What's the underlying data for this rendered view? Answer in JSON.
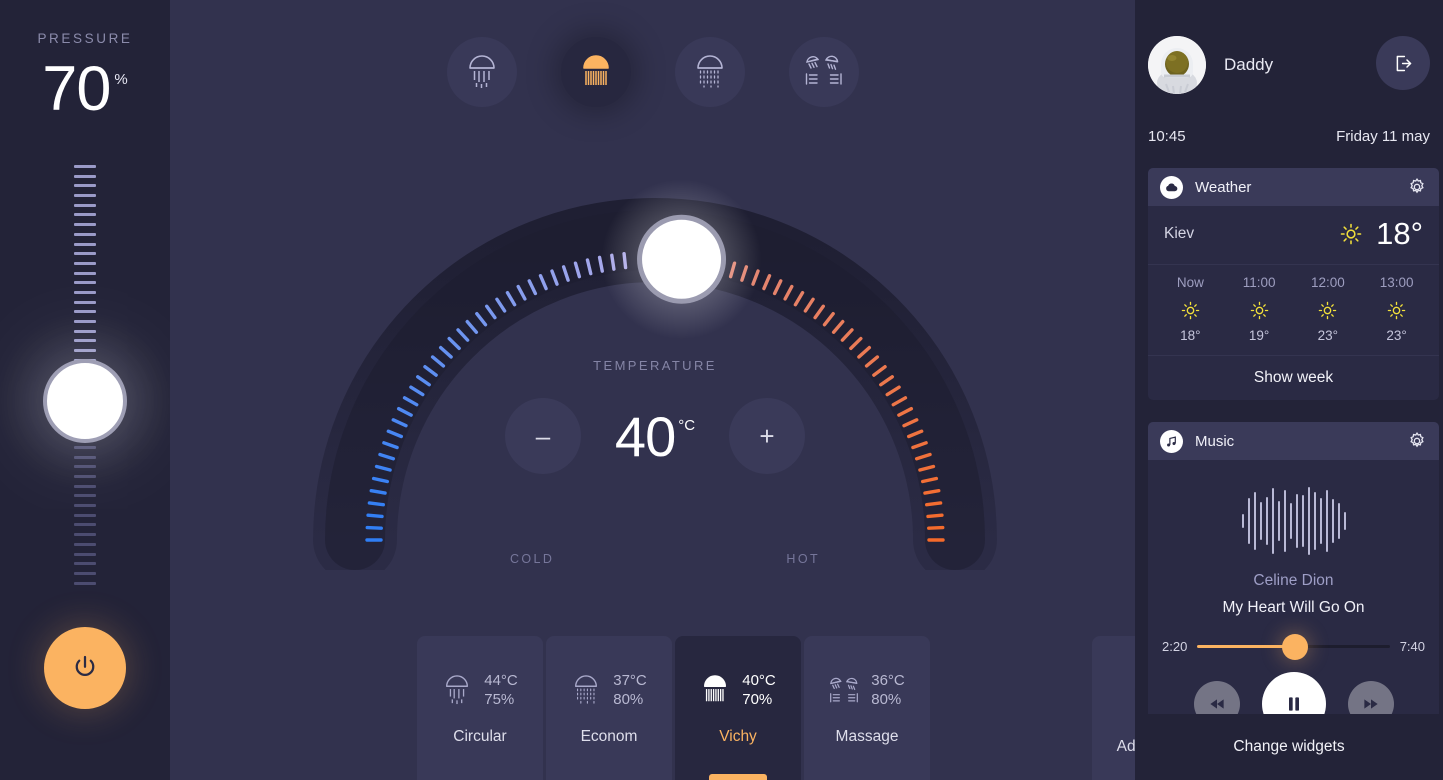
{
  "left_rail": {
    "pressure_label": "PRESSURE",
    "pressure_value": "70",
    "pressure_unit": "%",
    "power_icon": "power-icon",
    "slider_position_percent": 46
  },
  "modes": [
    {
      "id": "rain",
      "icon": "shower-head-rain-icon",
      "active": false
    },
    {
      "id": "waterfall",
      "icon": "shower-head-waterfall-icon",
      "active": true
    },
    {
      "id": "mist",
      "icon": "shower-head-mist-icon",
      "active": false
    },
    {
      "id": "jets",
      "icon": "shower-jets-icon",
      "active": false
    }
  ],
  "dial": {
    "title": "TEMPERATURE",
    "value": "40",
    "unit": "°C",
    "minus_label": "–",
    "plus_label": "+",
    "cold_label": "COLD",
    "hot_label": "HOT",
    "knob_angle_deg": -8,
    "cold_color": "#2f7ef5",
    "hot_color": "#f56a2a",
    "mid_color": "#c7b4e8"
  },
  "presets": {
    "items": [
      {
        "name": "Circular",
        "temp": "44°C",
        "pressure": "75%",
        "icon": "shower-head-rain-icon",
        "active": false
      },
      {
        "name": "Econom",
        "temp": "37°C",
        "pressure": "80%",
        "icon": "shower-head-mist-icon",
        "active": false
      },
      {
        "name": "Vichy",
        "temp": "40°C",
        "pressure": "70%",
        "icon": "shower-head-waterfall-icon",
        "active": true
      },
      {
        "name": "Massage",
        "temp": "36°C",
        "pressure": "80%",
        "icon": "shower-jets-icon",
        "active": false
      }
    ],
    "add_label": "Add Preset",
    "add_icon": "plus-icon"
  },
  "sidebar": {
    "user_name": "Daddy",
    "avatar": "astronaut-avatar",
    "logout_icon": "logout-icon",
    "time": "10:45",
    "date": "Friday 11 may",
    "weather": {
      "title": "Weather",
      "icon": "cloud-icon",
      "settings_icon": "gear-icon",
      "city": "Kiev",
      "current_icon": "sun-icon",
      "current_temp": "18°",
      "hours": [
        {
          "label": "Now",
          "icon": "sun-icon",
          "temp": "18°"
        },
        {
          "label": "11:00",
          "icon": "sun-icon",
          "temp": "19°"
        },
        {
          "label": "12:00",
          "icon": "sun-icon",
          "temp": "23°"
        },
        {
          "label": "13:00",
          "icon": "sun-icon",
          "temp": "23°"
        }
      ],
      "show_week_label": "Show week"
    },
    "music": {
      "title": "Music",
      "icon": "music-note-icon",
      "settings_icon": "gear-icon",
      "artist": "Celine Dion",
      "track": "My Heart Will Go On",
      "elapsed": "2:20",
      "duration": "7:40",
      "progress_percent": 51,
      "prev_icon": "rewind-icon",
      "play_icon": "pause-icon",
      "next_icon": "fast-forward-icon",
      "waveform": [
        14,
        46,
        58,
        38,
        48,
        66,
        40,
        62,
        36,
        54,
        52,
        68,
        58,
        46,
        62,
        44,
        36,
        18
      ]
    },
    "change_widgets_label": "Change widgets"
  },
  "colors": {
    "accent": "#fbb361",
    "background": "#32324e",
    "rail": "#232338",
    "widget_header": "#3a3a59",
    "sun_yellow": "#f2e03a"
  }
}
